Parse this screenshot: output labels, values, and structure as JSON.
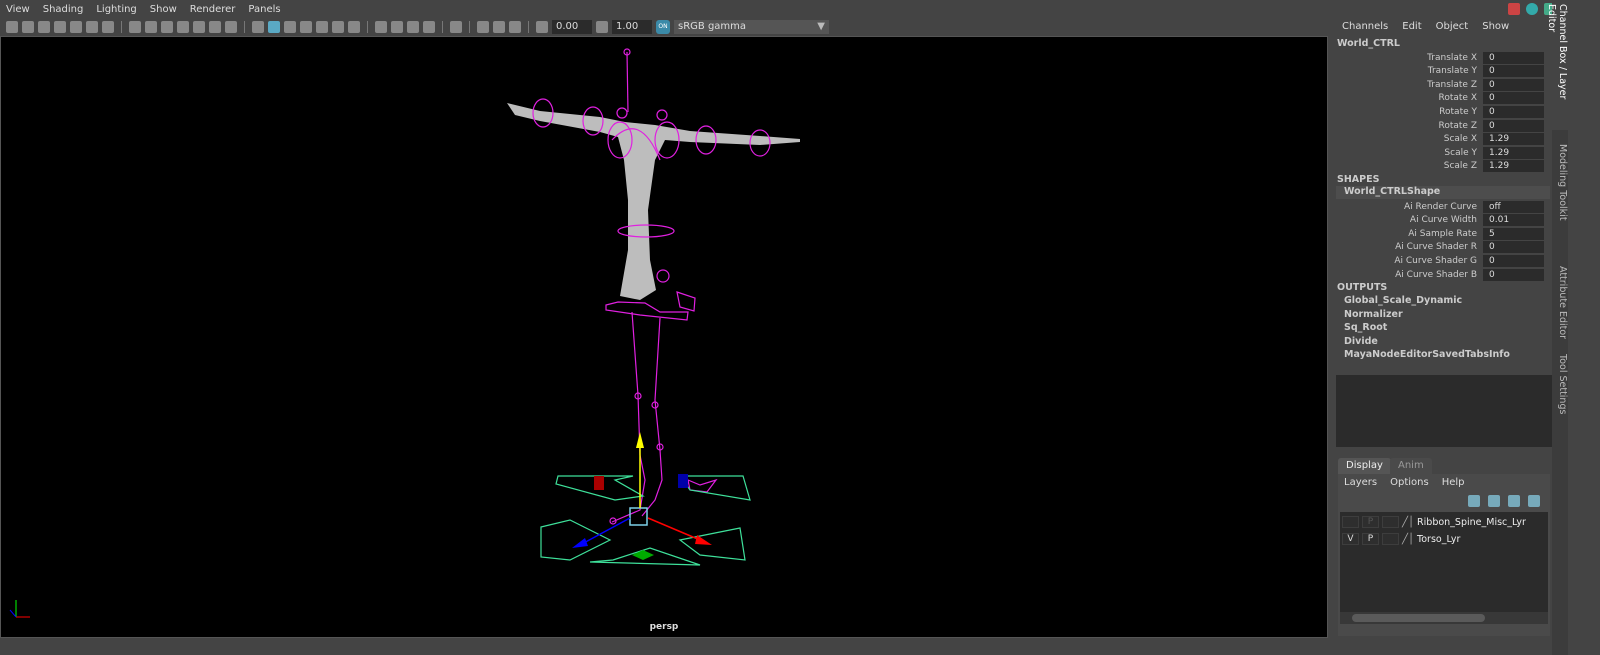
{
  "viewport": {
    "menu": [
      "View",
      "Shading",
      "Lighting",
      "Show",
      "Renderer",
      "Panels"
    ],
    "exposure": "0.00",
    "gamma": "1.00",
    "color_space": "sRGB gamma",
    "on_badge": "ON",
    "camera": "persp"
  },
  "channel_box": {
    "menu": [
      "Channels",
      "Edit",
      "Object",
      "Show"
    ],
    "object": "World_CTRL",
    "attrs": [
      {
        "label": "Translate X",
        "value": "0"
      },
      {
        "label": "Translate Y",
        "value": "0"
      },
      {
        "label": "Translate Z",
        "value": "0"
      },
      {
        "label": "Rotate X",
        "value": "0"
      },
      {
        "label": "Rotate Y",
        "value": "0"
      },
      {
        "label": "Rotate Z",
        "value": "0"
      },
      {
        "label": "Scale X",
        "value": "1.29"
      },
      {
        "label": "Scale Y",
        "value": "1.29"
      },
      {
        "label": "Scale Z",
        "value": "1.29"
      }
    ],
    "shapes_header": "SHAPES",
    "shape_name": "World_CTRLShape",
    "shape_attrs": [
      {
        "label": "Ai Render Curve",
        "value": "off"
      },
      {
        "label": "Ai Curve Width",
        "value": "0.01"
      },
      {
        "label": "Ai Sample Rate",
        "value": "5"
      },
      {
        "label": "Ai Curve Shader R",
        "value": "0"
      },
      {
        "label": "Ai Curve Shader G",
        "value": "0"
      },
      {
        "label": "Ai Curve Shader B",
        "value": "0"
      }
    ],
    "outputs_header": "OUTPUTS",
    "outputs": [
      "Global_Scale_Dynamic",
      "Normalizer",
      "Sq_Root",
      "Divide",
      "MayaNodeEditorSavedTabsInfo"
    ]
  },
  "side_tabs": [
    "Channel Box / Layer Editor",
    "Modeling Toolkit",
    "Attribute Editor",
    "Tool Settings"
  ],
  "layer_editor": {
    "tabs": [
      "Display",
      "Anim"
    ],
    "menu": [
      "Layers",
      "Options",
      "Help"
    ],
    "layers": [
      {
        "v": "",
        "p": "P",
        "name": "Ribbon_Spine_Misc_Lyr"
      },
      {
        "v": "V",
        "p": "P",
        "name": "Torso_Lyr"
      }
    ]
  }
}
